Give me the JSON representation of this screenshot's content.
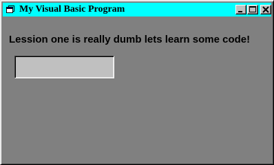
{
  "window": {
    "title": "My Visual Basic Program",
    "background_color": "#808080",
    "title_bar_color": "#00ffff",
    "system_menu_icon": "window-icon",
    "caption_buttons": [
      "minimize-icon",
      "maximize-icon",
      "close-icon"
    ]
  },
  "form": {
    "label_text": "Lession one is really dumb lets learn some code!",
    "textbox": {
      "value": "",
      "background_color": "#c0c0c0"
    }
  }
}
